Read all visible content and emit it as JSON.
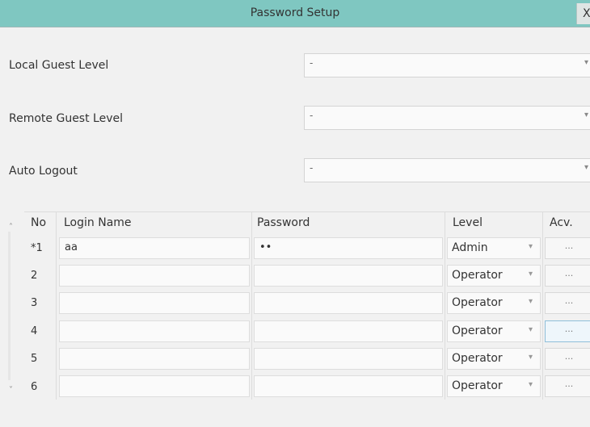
{
  "window": {
    "title": "Password Setup",
    "close_label": "X"
  },
  "settings": {
    "local_guest_level": {
      "label": "Local Guest Level",
      "value": "-"
    },
    "remote_guest_level": {
      "label": "Remote Guest Level",
      "value": "-"
    },
    "auto_logout": {
      "label": "Auto Logout",
      "value": "-"
    }
  },
  "icons": {
    "dropdown_arrow": "▾",
    "scroll_up": "˄",
    "scroll_down": "˅"
  },
  "table": {
    "headers": {
      "no": "No",
      "login_name": "Login Name",
      "password": "Password",
      "level": "Level",
      "acv": "Acv."
    },
    "rows": [
      {
        "no": "*1",
        "login": "aa",
        "password": "••",
        "level": "Admin",
        "acv": "..."
      },
      {
        "no": "2",
        "login": "",
        "password": "",
        "level": "Operator",
        "acv": "..."
      },
      {
        "no": "3",
        "login": "",
        "password": "",
        "level": "Operator",
        "acv": "..."
      },
      {
        "no": "4",
        "login": "",
        "password": "",
        "level": "Operator",
        "acv": "..."
      },
      {
        "no": "5",
        "login": "",
        "password": "",
        "level": "Operator",
        "acv": "..."
      },
      {
        "no": "6",
        "login": "",
        "password": "",
        "level": "Operator",
        "acv": "..."
      }
    ]
  }
}
